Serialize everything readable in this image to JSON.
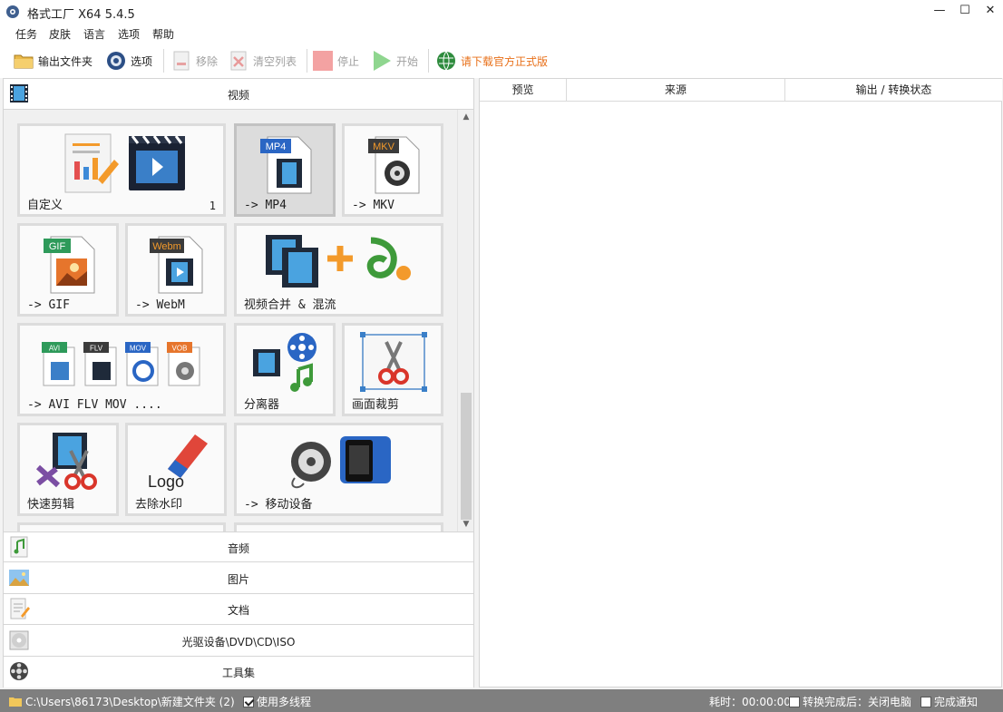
{
  "window": {
    "title": "格式工厂 X64 5.4.5",
    "controls": {
      "minimize": "—",
      "maximize": "☐",
      "close": "✕"
    }
  },
  "menu": [
    "任务",
    "皮肤",
    "语言",
    "选项",
    "帮助"
  ],
  "toolbar": {
    "output_folder": "输出文件夹",
    "options": "选项",
    "remove": "移除",
    "clear_list": "清空列表",
    "stop": "停止",
    "start": "开始",
    "download": "请下载官方正式版"
  },
  "left_panel": {
    "active_category": "视频",
    "tiles": [
      {
        "label": "自定义",
        "count": "1",
        "icon": "custom-icon"
      },
      {
        "label": "-> MP4",
        "icon": "mp4-icon",
        "badge": "MP4",
        "selected": true
      },
      {
        "label": "-> MKV",
        "icon": "mkv-icon",
        "badge": "MKV"
      },
      {
        "label": "-> GIF",
        "icon": "gif-icon",
        "badge": "GIF"
      },
      {
        "label": "-> WebM",
        "icon": "webm-icon",
        "badge": "Webm"
      },
      {
        "label": "视频合并 & 混流",
        "icon": "merge-icon"
      },
      {
        "label": "-> AVI FLV MOV ....",
        "icon": "avi-flv-mov-icon",
        "badges": [
          "AVI",
          "FLV",
          "MOV",
          "VOB"
        ]
      },
      {
        "label": "分离器",
        "icon": "demux-icon"
      },
      {
        "label": "画面裁剪",
        "icon": "crop-icon"
      },
      {
        "label": "快速剪辑",
        "icon": "quick-clip-icon"
      },
      {
        "label": "去除水印",
        "icon": "remove-watermark-icon",
        "logo_text": "Logo"
      },
      {
        "label": "-> 移动设备",
        "icon": "mobile-device-icon"
      }
    ],
    "categories": [
      {
        "label": "音频",
        "icon": "music-note-icon"
      },
      {
        "label": "图片",
        "icon": "picture-icon"
      },
      {
        "label": "文档",
        "icon": "document-icon"
      },
      {
        "label": "光驱设备\\DVD\\CD\\ISO",
        "icon": "disc-icon"
      },
      {
        "label": "工具集",
        "icon": "film-reel-icon"
      }
    ]
  },
  "task_table": {
    "columns": [
      "预览",
      "来源",
      "输出 / 转换状态"
    ]
  },
  "statusbar": {
    "path": "C:\\Users\\86173\\Desktop\\新建文件夹 (2)",
    "multithread_label": "使用多线程",
    "multithread_checked": true,
    "elapsed": "耗时：00:00:00",
    "shutdown_label": "转换完成后：关闭电脑",
    "shutdown_checked": false,
    "notify_label": "完成通知",
    "notify_checked": false
  },
  "colors": {
    "accent_orange": "#e8701a",
    "status_bar": "#7f7f7f",
    "selected_tile": "#dcdcdc"
  }
}
